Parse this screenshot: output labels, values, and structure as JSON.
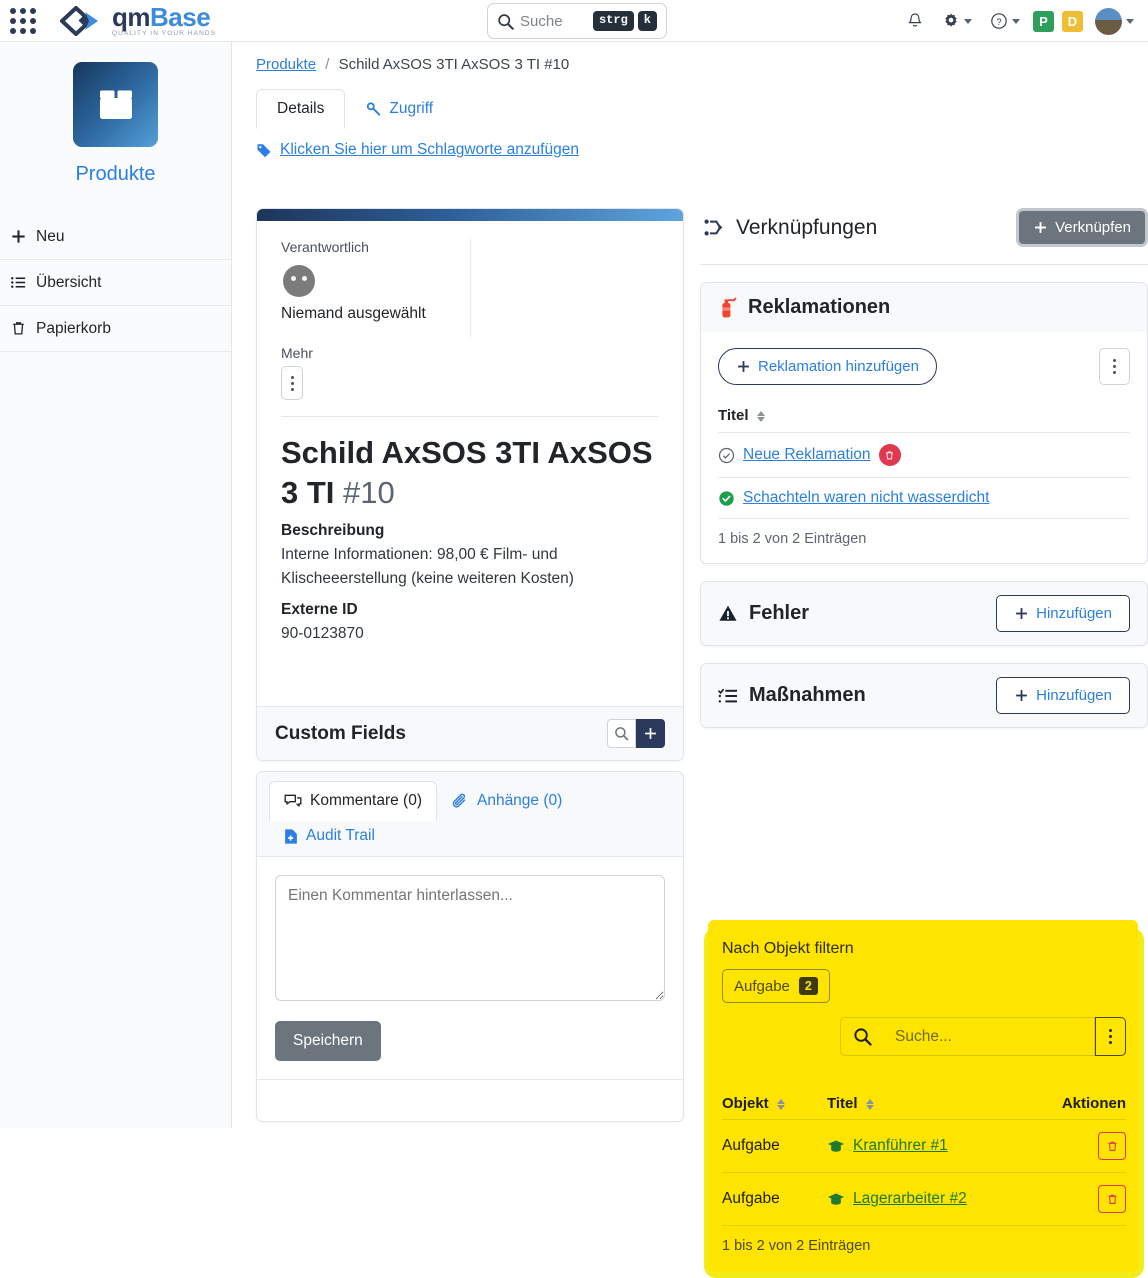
{
  "topbar": {
    "brand_name_1": "qm",
    "brand_name_2": "Base",
    "brand_tagline": "QUALITY IN YOUR HANDS",
    "search_placeholder": "Suche",
    "kbd_modifier": "strg",
    "kbd_key": "k",
    "badge_p": "P",
    "badge_d": "D",
    "colors": {
      "badge_p": "#2e9e5b",
      "badge_d": "#f0be34",
      "brand_blue": "#3d8bdd"
    }
  },
  "sidebar": {
    "module_name": "Produkte",
    "items": [
      {
        "label": "Neu",
        "icon": "plus-icon"
      },
      {
        "label": "Übersicht",
        "icon": "list-icon"
      },
      {
        "label": "Papierkorb",
        "icon": "trash-icon"
      }
    ]
  },
  "breadcrumb": {
    "root": "Produkte",
    "separator": "/",
    "current": "Schild AxSOS 3TI AxSOS 3 TI #10"
  },
  "tabs": [
    {
      "label": "Details",
      "active": true
    },
    {
      "label": "Zugriff",
      "active": false,
      "icon": "key-icon"
    }
  ],
  "tag_link": "Klicken Sie hier um Schlagworte anzufügen",
  "detail_card": {
    "responsible_label": "Verantwortlich",
    "responsible_value": "Niemand ausgewählt",
    "more_label": "Mehr",
    "title": "Schild AxSOS 3TI AxSOS 3 TI",
    "title_number": "#10",
    "fields": [
      {
        "label": "Beschreibung",
        "value": "Interne Informationen: 98,00 € Film- und Klischeeerstellung (keine weiteren Kosten)"
      },
      {
        "label": "Externe ID",
        "value": "90-0123870"
      }
    ],
    "custom_fields_title": "Custom Fields",
    "custom_fields_search_icon": "search-icon",
    "custom_fields_add_icon": "plus-icon"
  },
  "comments": {
    "tabs": [
      {
        "label": "Kommentare (0)",
        "active": true,
        "icon": "comments-icon"
      },
      {
        "label": "Anhänge (0)",
        "active": false,
        "icon": "paperclip-icon"
      }
    ],
    "audit_trail": "Audit Trail",
    "textarea_placeholder": "Einen Kommentar hinterlassen...",
    "save_label": "Speichern"
  },
  "links_panel": {
    "title": "Verknüpfungen",
    "link_button": "Verknüpfen"
  },
  "reklamationen": {
    "title": "Reklamationen",
    "add_button": "Reklamation hinzufügen",
    "column_title": "Titel",
    "rows": [
      {
        "title": "Neue Reklamation",
        "status": "open",
        "has_delete": true
      },
      {
        "title": "Schachteln waren nicht wasserdicht",
        "status": "done",
        "has_delete": false
      }
    ],
    "footer": "1 bis 2 von 2 Einträgen"
  },
  "fehler": {
    "title": "Fehler",
    "add_button": "Hinzufügen"
  },
  "massnahmen": {
    "title": "Maßnahmen",
    "add_button": "Hinzufügen"
  },
  "highlighted": {
    "filter_label": "Nach Objekt filtern",
    "chip_label": "Aufgabe",
    "chip_count": "2",
    "search_placeholder": "Suche...",
    "columns": [
      "Objekt",
      "Titel",
      "Aktionen"
    ],
    "rows": [
      {
        "objekt": "Aufgabe",
        "titel": "Kranführer #1",
        "icon": "graduation-cap-icon"
      },
      {
        "objekt": "Aufgabe",
        "titel": "Lagerarbeiter #2",
        "icon": "graduation-cap-icon"
      }
    ],
    "footer": "1 bis 2 von 2 Einträgen",
    "colors": {
      "core": "#ffe400",
      "smudge": "#f2ec18",
      "link": "#1d7a2f"
    }
  }
}
